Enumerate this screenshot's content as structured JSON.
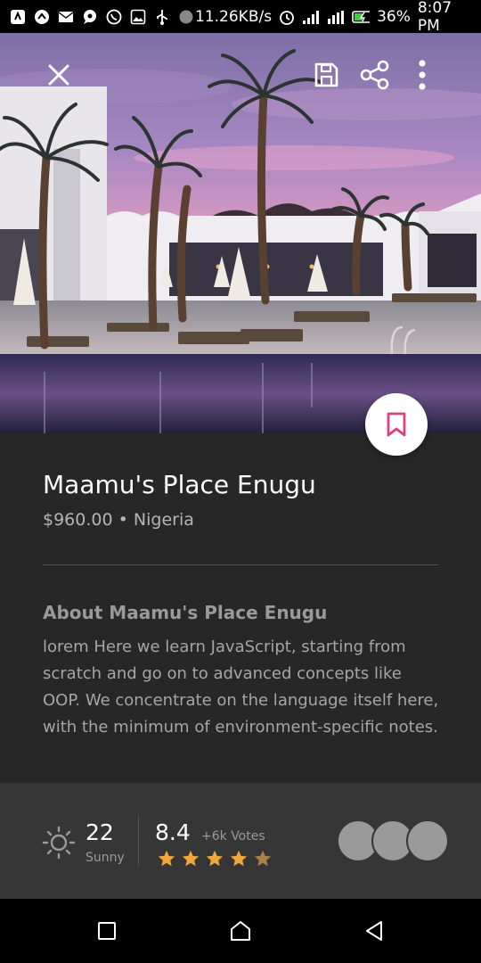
{
  "status_bar": {
    "speed": "11.26KB/s",
    "battery": "36%",
    "time": "8:07 PM",
    "left_icons": [
      "app-icon",
      "chevron-up-icon",
      "mail-icon",
      "chat-icon",
      "whatsapp-icon",
      "gallery-icon",
      "usb-icon",
      "record-icon"
    ],
    "right_icons": [
      "alarm-icon",
      "signal-icon",
      "data-icon",
      "battery-icon"
    ]
  },
  "hero": {
    "icons": [
      "close-icon",
      "save-icon",
      "share-icon",
      "more-vertical-icon",
      "bookmark-icon"
    ]
  },
  "listing": {
    "title": "Maamu's Place Enugu",
    "price": "$960.00",
    "separator": "•",
    "location": "Nigeria",
    "about_title": "About Maamu's Place Enugu",
    "about_text": "lorem Here we learn JavaScript, starting from scratch and go on to advanced concepts like OOP. We concentrate on the language itself here, with the minimum of environment-specific notes."
  },
  "weather": {
    "icon": "sun-icon",
    "temperature": "22",
    "condition": "Sunny"
  },
  "rating": {
    "score": "8.4",
    "votes": "+6k Votes",
    "stars_filled": 4,
    "stars_total": 5
  },
  "avatars": {
    "count": 3
  },
  "colors": {
    "accent": "#e0407a",
    "star": "#f0a83a",
    "star_dim": "#a8804a",
    "panel": "#272727",
    "bottom_panel": "#363636",
    "avatar": "#9a9a9a"
  },
  "nav_bar": {
    "icons": [
      "recent-apps-icon",
      "home-icon",
      "back-icon"
    ]
  }
}
